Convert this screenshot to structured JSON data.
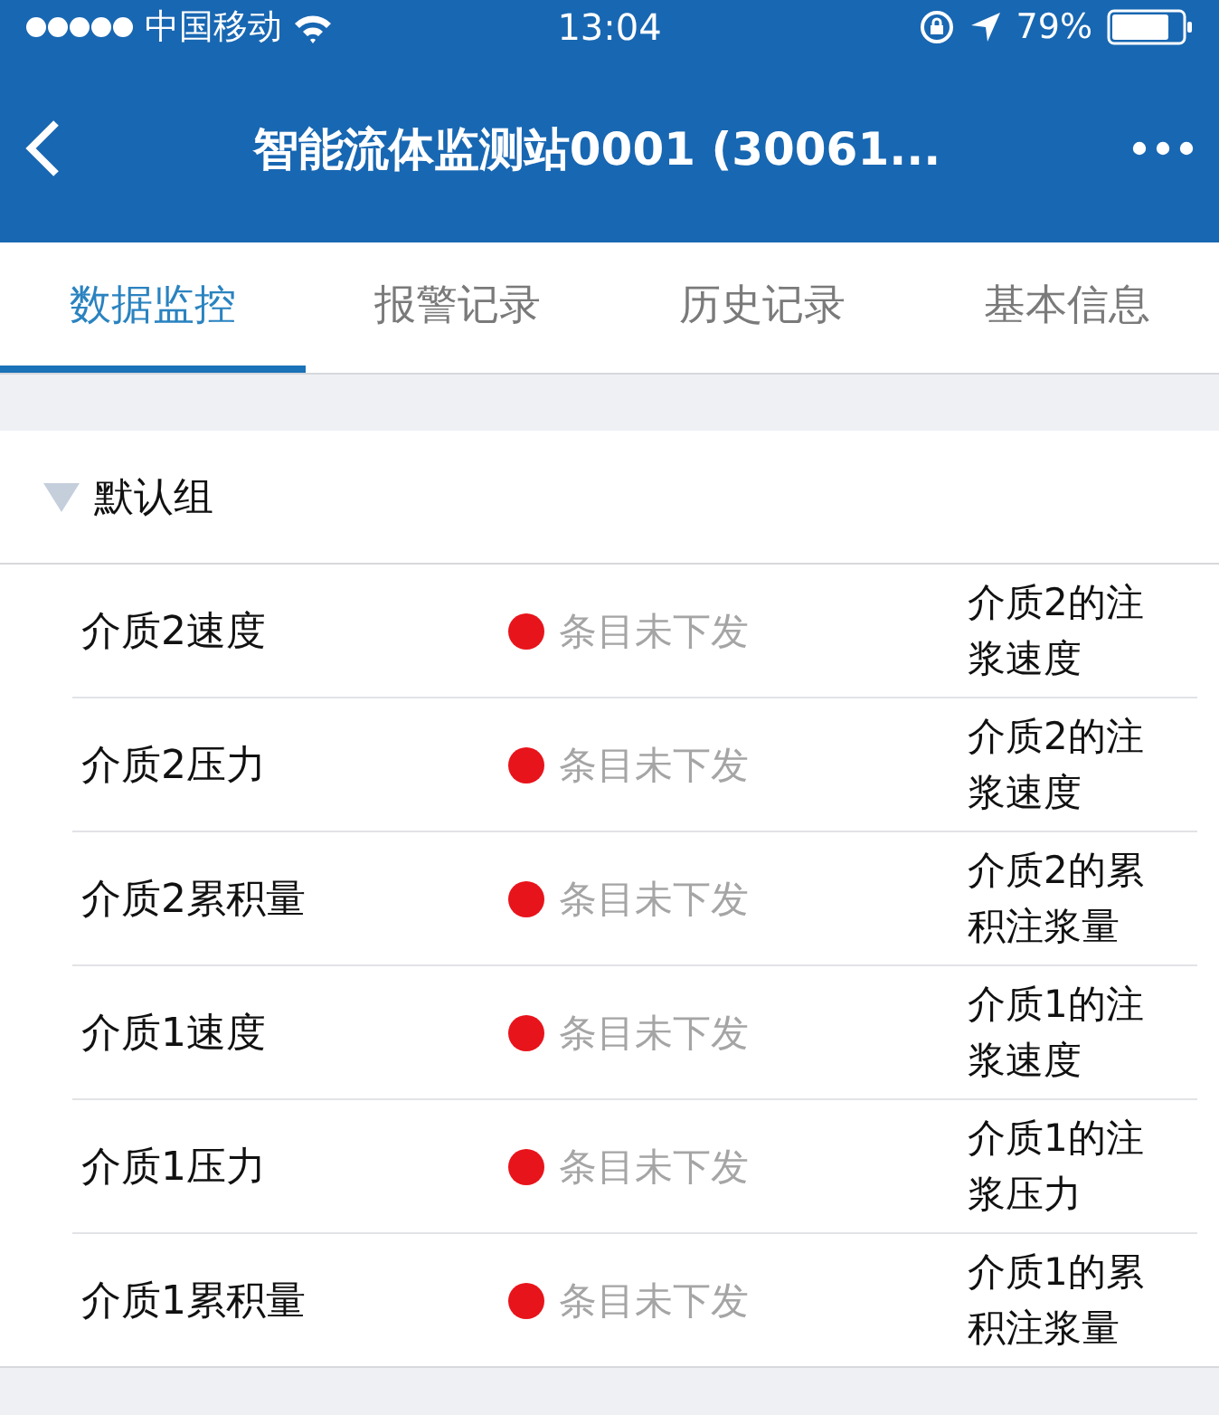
{
  "status_bar": {
    "carrier": "中国移动",
    "time": "13:04",
    "battery": "79%"
  },
  "nav": {
    "title": "智能流体监测站0001 (30061..."
  },
  "tabs": [
    {
      "label": "数据监控",
      "selected": true
    },
    {
      "label": "报警记录",
      "selected": false
    },
    {
      "label": "历史记录",
      "selected": false
    },
    {
      "label": "基本信息",
      "selected": false
    }
  ],
  "group": {
    "name": "默认组",
    "expanded": true,
    "items": [
      {
        "name": "介质2速度",
        "status": "条目未下发",
        "description": "介质2的注浆速度"
      },
      {
        "name": "介质2压力",
        "status": "条目未下发",
        "description": "介质2的注浆速度"
      },
      {
        "name": "介质2累积量",
        "status": "条目未下发",
        "description": "介质2的累积注浆量"
      },
      {
        "name": "介质1速度",
        "status": "条目未下发",
        "description": "介质1的注浆速度"
      },
      {
        "name": "介质1压力",
        "status": "条目未下发",
        "description": "介质1的注浆压力"
      },
      {
        "name": "介质1累积量",
        "status": "条目未下发",
        "description": "介质1的累积注浆量"
      }
    ]
  }
}
